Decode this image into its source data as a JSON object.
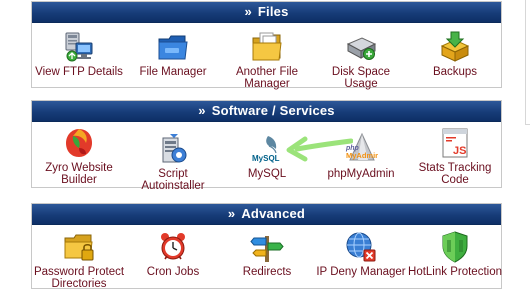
{
  "sections": [
    {
      "title": "Files",
      "items": [
        {
          "label": "View FTP Details",
          "icon": "ftp-computer-icon"
        },
        {
          "label": "File Manager",
          "icon": "folder-icon"
        },
        {
          "label": "Another File Manager",
          "icon": "folder-documents-icon"
        },
        {
          "label": "Disk Space Usage",
          "icon": "hard-drive-icon"
        },
        {
          "label": "Backups",
          "icon": "backup-box-icon"
        }
      ]
    },
    {
      "title": "Software / Services",
      "items": [
        {
          "label": "Zyro Website Builder",
          "icon": "zyro-icon"
        },
        {
          "label": "Script Autoinstaller",
          "icon": "installer-icon"
        },
        {
          "label": "MySQL",
          "icon": "mysql-icon",
          "logo_text": "MySQL"
        },
        {
          "label": "phpMyAdmin",
          "icon": "phpmyadmin-icon",
          "logo_text_1": "php",
          "logo_text_2": "MyAdmin"
        },
        {
          "label": "Stats Tracking Code",
          "icon": "js-stats-icon",
          "logo_text": "JS"
        }
      ]
    },
    {
      "title": "Advanced",
      "items": [
        {
          "label": "Password Protect Directories",
          "icon": "locked-folder-icon"
        },
        {
          "label": "Cron Jobs",
          "icon": "alarm-clock-icon"
        },
        {
          "label": "Redirects",
          "icon": "signpost-icon"
        },
        {
          "label": "IP Deny Manager",
          "icon": "globe-deny-icon"
        },
        {
          "label": "HotLink Protection",
          "icon": "shield-icon"
        }
      ]
    }
  ],
  "annotation": {
    "arrow_color": "#9be37a",
    "points_to": "MySQL"
  },
  "colors": {
    "header_top": "#2d5899",
    "header_bottom": "#0e2f66",
    "label_text": "#6a0f1f",
    "border": "#c8c8c8"
  }
}
